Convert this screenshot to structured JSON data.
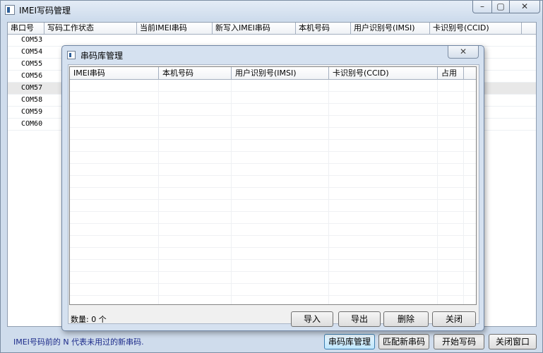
{
  "window": {
    "title": "IMEI写码管理",
    "minimize": "–",
    "maximize": "▢",
    "close": "✕"
  },
  "grid": {
    "columns": [
      "串口号",
      "写码工作状态",
      "当前IMEI串码",
      "新写入IMEI串码",
      "本机号码",
      "用户识别号(IMSI)",
      "卡识别号(CCID)"
    ],
    "rows": [
      "COM53",
      "COM54",
      "COM55",
      "COM56",
      "COM57",
      "COM58",
      "COM59",
      "COM60"
    ]
  },
  "footer": {
    "note": "IMEI号码前的 N 代表未用过的新串码.",
    "buttons": {
      "library": "串码库管理",
      "match": "匹配新串码",
      "start": "开始写码",
      "close": "关闭窗口"
    }
  },
  "dialog": {
    "title": "串码库管理",
    "close": "✕",
    "columns": [
      "IMEI串码",
      "本机号码",
      "用户识别号(IMSI)",
      "卡识别号(CCID)",
      "占用"
    ],
    "count_label": "数量: 0 个",
    "buttons": {
      "import": "导入",
      "export": "导出",
      "delete": "删除",
      "close": "关闭"
    }
  }
}
